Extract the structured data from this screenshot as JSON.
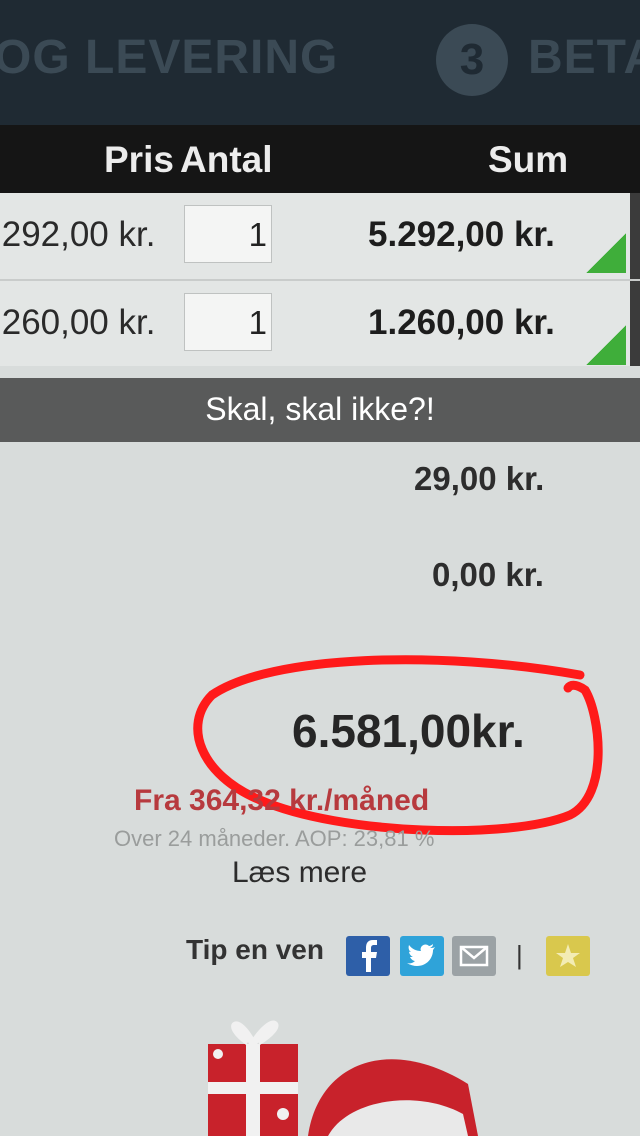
{
  "steps": {
    "left_label": "OG LEVERING",
    "step_number": "3",
    "right_label": "BETA"
  },
  "table": {
    "headers": {
      "price": "Pris",
      "qty": "Antal",
      "sum": "Sum"
    },
    "rows": [
      {
        "price": ".292,00 kr.",
        "qty": "1",
        "sum": "5.292,00 kr."
      },
      {
        "price": ".260,00 kr.",
        "qty": "1",
        "sum": "1.260,00 kr."
      }
    ]
  },
  "summary": {
    "shipping": "29,00 kr.",
    "fee": "0,00 kr.",
    "total": "6.581,00kr.",
    "monthly": "Fra 364,32 kr./måned",
    "terms": "Over 24 måneder. AOP: 23,81 %",
    "read_more": "Læs mere"
  },
  "share": {
    "label": "Tip en ven",
    "separator": "|"
  },
  "caption": {
    "text": "Skal, skal ikke?!"
  },
  "colors": {
    "header_bg": "#151515",
    "accent_green": "#3fae3a",
    "monthly_red": "#b73a3e",
    "ring_red": "#ff1a1a",
    "facebook": "#2e5fa8",
    "twitter": "#2fa3d9"
  },
  "icons": [
    "facebook-icon",
    "twitter-icon",
    "mail-icon",
    "star-icon"
  ]
}
